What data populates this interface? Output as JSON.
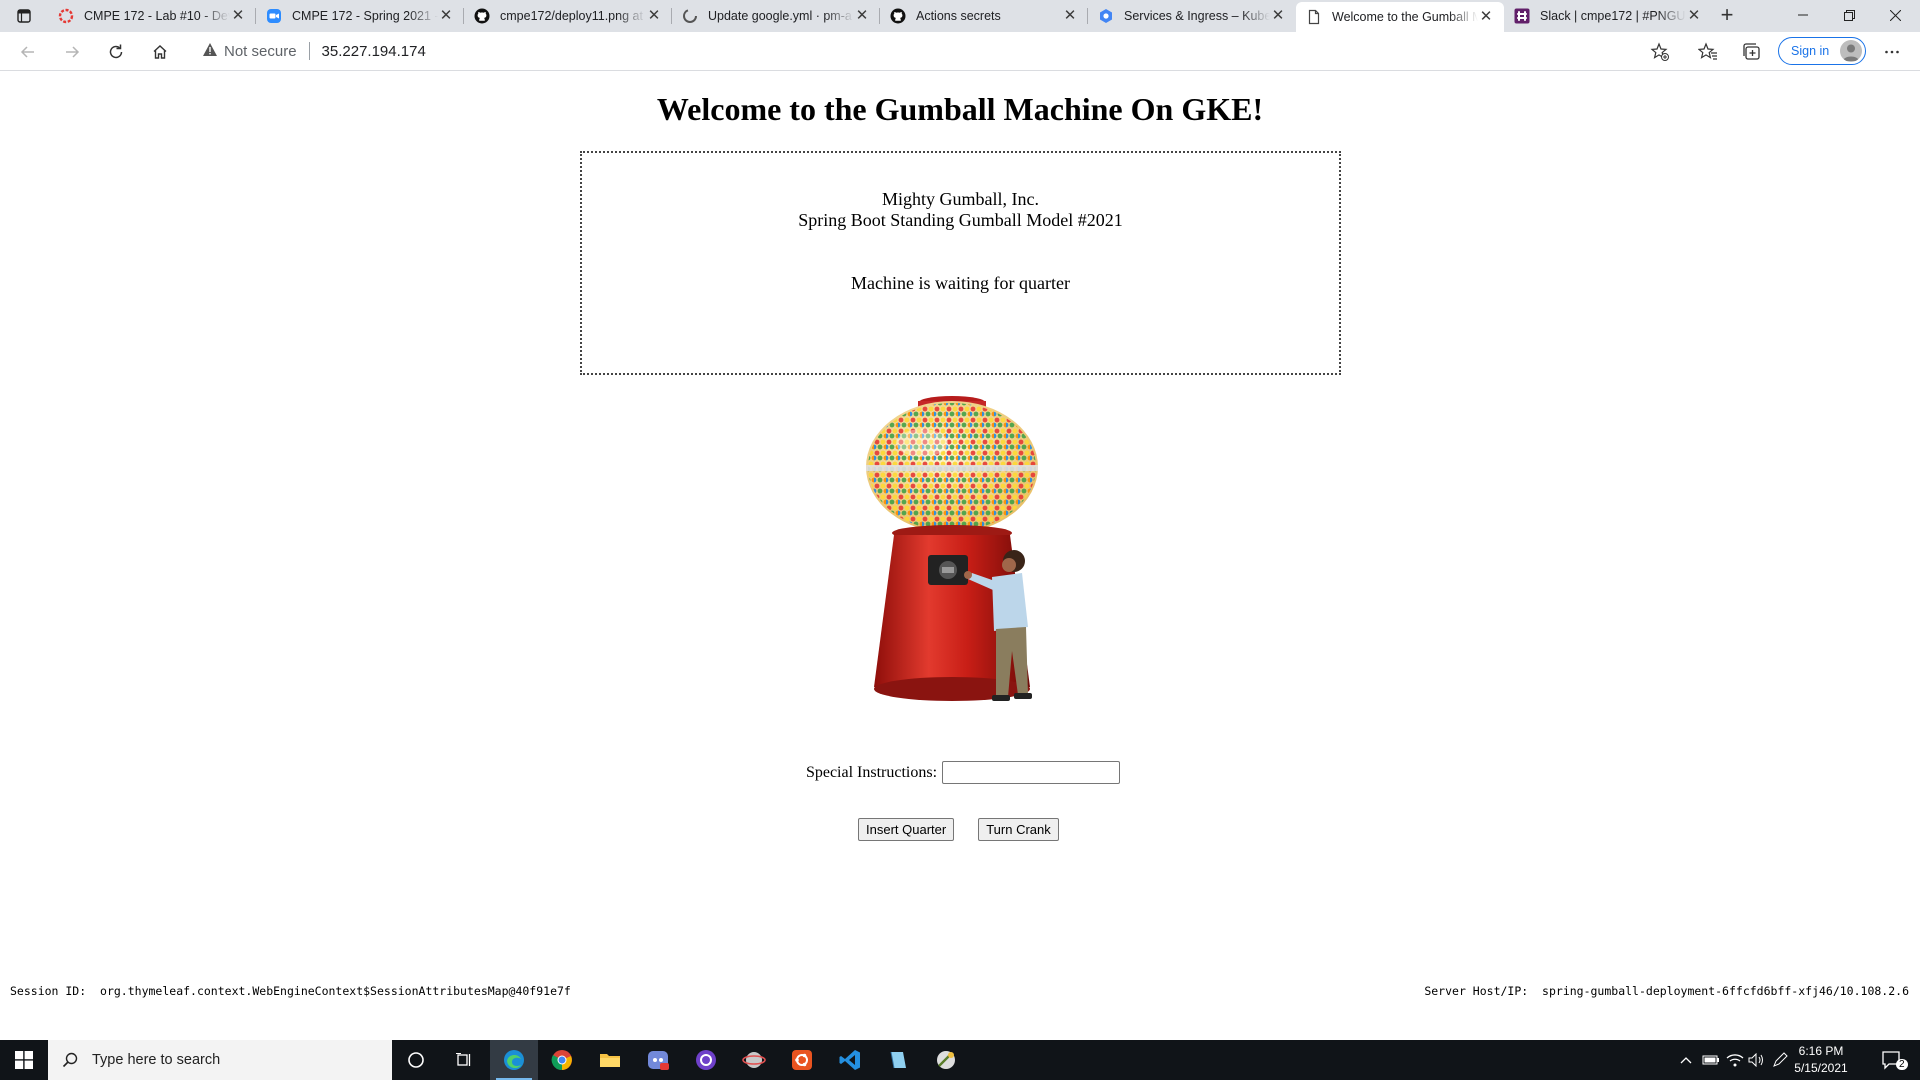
{
  "browser": {
    "tabs": [
      {
        "title": "CMPE 172 - Lab #10 - Dev",
        "icon": "red-ring-icon",
        "active": false
      },
      {
        "title": "CMPE 172 - Spring 2021 -",
        "icon": "zoom-icon",
        "active": false
      },
      {
        "title": "cmpe172/deploy11.png at",
        "icon": "github-icon",
        "active": false
      },
      {
        "title": "Update google.yml · pm-a",
        "icon": "loading-icon",
        "active": false
      },
      {
        "title": "Actions secrets",
        "icon": "github-icon",
        "active": false
      },
      {
        "title": "Services & Ingress – Kuber",
        "icon": "gcp-icon",
        "active": false
      },
      {
        "title": "Welcome to the Gumball M",
        "icon": "page-icon",
        "active": true
      },
      {
        "title": "Slack | cmpe172 | #PNGUY",
        "icon": "slack-icon",
        "active": false
      }
    ],
    "security_label": "Not secure",
    "url": "35.227.194.174",
    "signin_label": "Sign in"
  },
  "page": {
    "title": "Welcome to the Gumball Machine On GKE!",
    "company": "Mighty Gumball, Inc.",
    "model": "Spring Boot Standing Gumball Model #2021",
    "state": "Machine is waiting for quarter",
    "instructions_label": "Special Instructions:",
    "instructions_value": "",
    "insert_button": "Insert Quarter",
    "crank_button": "Turn Crank",
    "session_label": "Session ID:",
    "session_id": "org.thymeleaf.context.WebEngineContext$SessionAttributesMap@40f91e7f",
    "server_label": "Server Host/IP:",
    "server_host": "spring-gumball-deployment-6ffcfd6bff-xfj46/10.108.2.6"
  },
  "taskbar": {
    "search_placeholder": "Type here to search",
    "time": "6:16 PM",
    "date": "5/15/2021",
    "notification_count": "2"
  },
  "colors": {
    "tab_strip": "#dee1e6",
    "taskbar": "#101418",
    "machine_red": "#d0201a",
    "edge_blue": "#1a73e8"
  }
}
